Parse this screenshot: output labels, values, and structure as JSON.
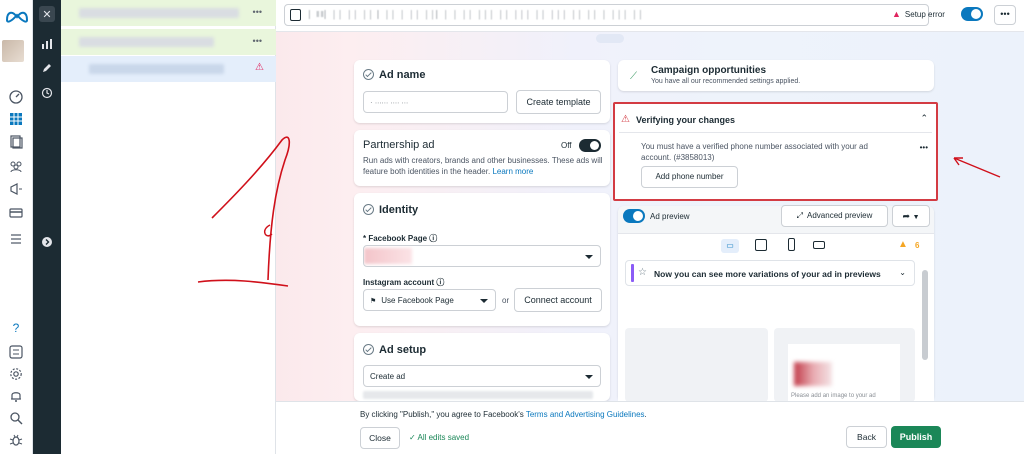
{
  "topbar": {
    "breadcrumb_text": "▏‖‖▏││ ││ ││ ▏││ │ ││ ││▏│ │ ││ │││ ││ │││ ││ │││ ││ ││ │ │││ ││",
    "setup_error": "Setup error",
    "more": "•••"
  },
  "ad_name": {
    "title": "Ad name",
    "value": "· ∙∙∙∙∙∙ ∙∙∙∙ ∙∙∙",
    "create_template": "Create template"
  },
  "partnership": {
    "title": "Partnership ad",
    "toggle_label": "Off",
    "description": "Run ads with creators, brands and other businesses. These ads will feature both identities in the header.",
    "learn_more": "Learn more"
  },
  "identity": {
    "title": "Identity",
    "facebook_page_label": "* Facebook Page ⓘ",
    "instagram_label": "Instagram account ⓘ",
    "instagram_value": "Use Facebook Page",
    "or": "or",
    "connect_account": "Connect account"
  },
  "ad_setup": {
    "title": "Ad setup",
    "select_value": "Create ad"
  },
  "campaign_opportunities": {
    "title": "Campaign opportunities",
    "subtitle": "You have all our recommended settings applied."
  },
  "verifying": {
    "title": "Verifying your changes",
    "message": "You must have a verified phone number associated with your ad account. (#3858013)",
    "button": "Add phone number",
    "more": "•••"
  },
  "ad_preview": {
    "label": "Ad preview",
    "advanced_preview": "Advanced preview",
    "warning_count": "6",
    "variations_banner": "Now you can see more variations of your ad in previews",
    "blurred_caption": "Please add an image to your ad"
  },
  "footer": {
    "agreement_prefix": "By clicking \"Publish,\" you agree to Facebook's ",
    "terms_link": "Terms and Advertising Guidelines",
    "agreement_suffix": ".",
    "close": "Close",
    "saved_status": "All edits saved",
    "back": "Back",
    "publish": "Publish"
  },
  "colors": {
    "primary_blue": "#0a78be",
    "publish_green": "#1b8758",
    "error_red": "#d33b43",
    "warning_orange": "#f5a623",
    "dark_panel": "#1c2b33"
  }
}
